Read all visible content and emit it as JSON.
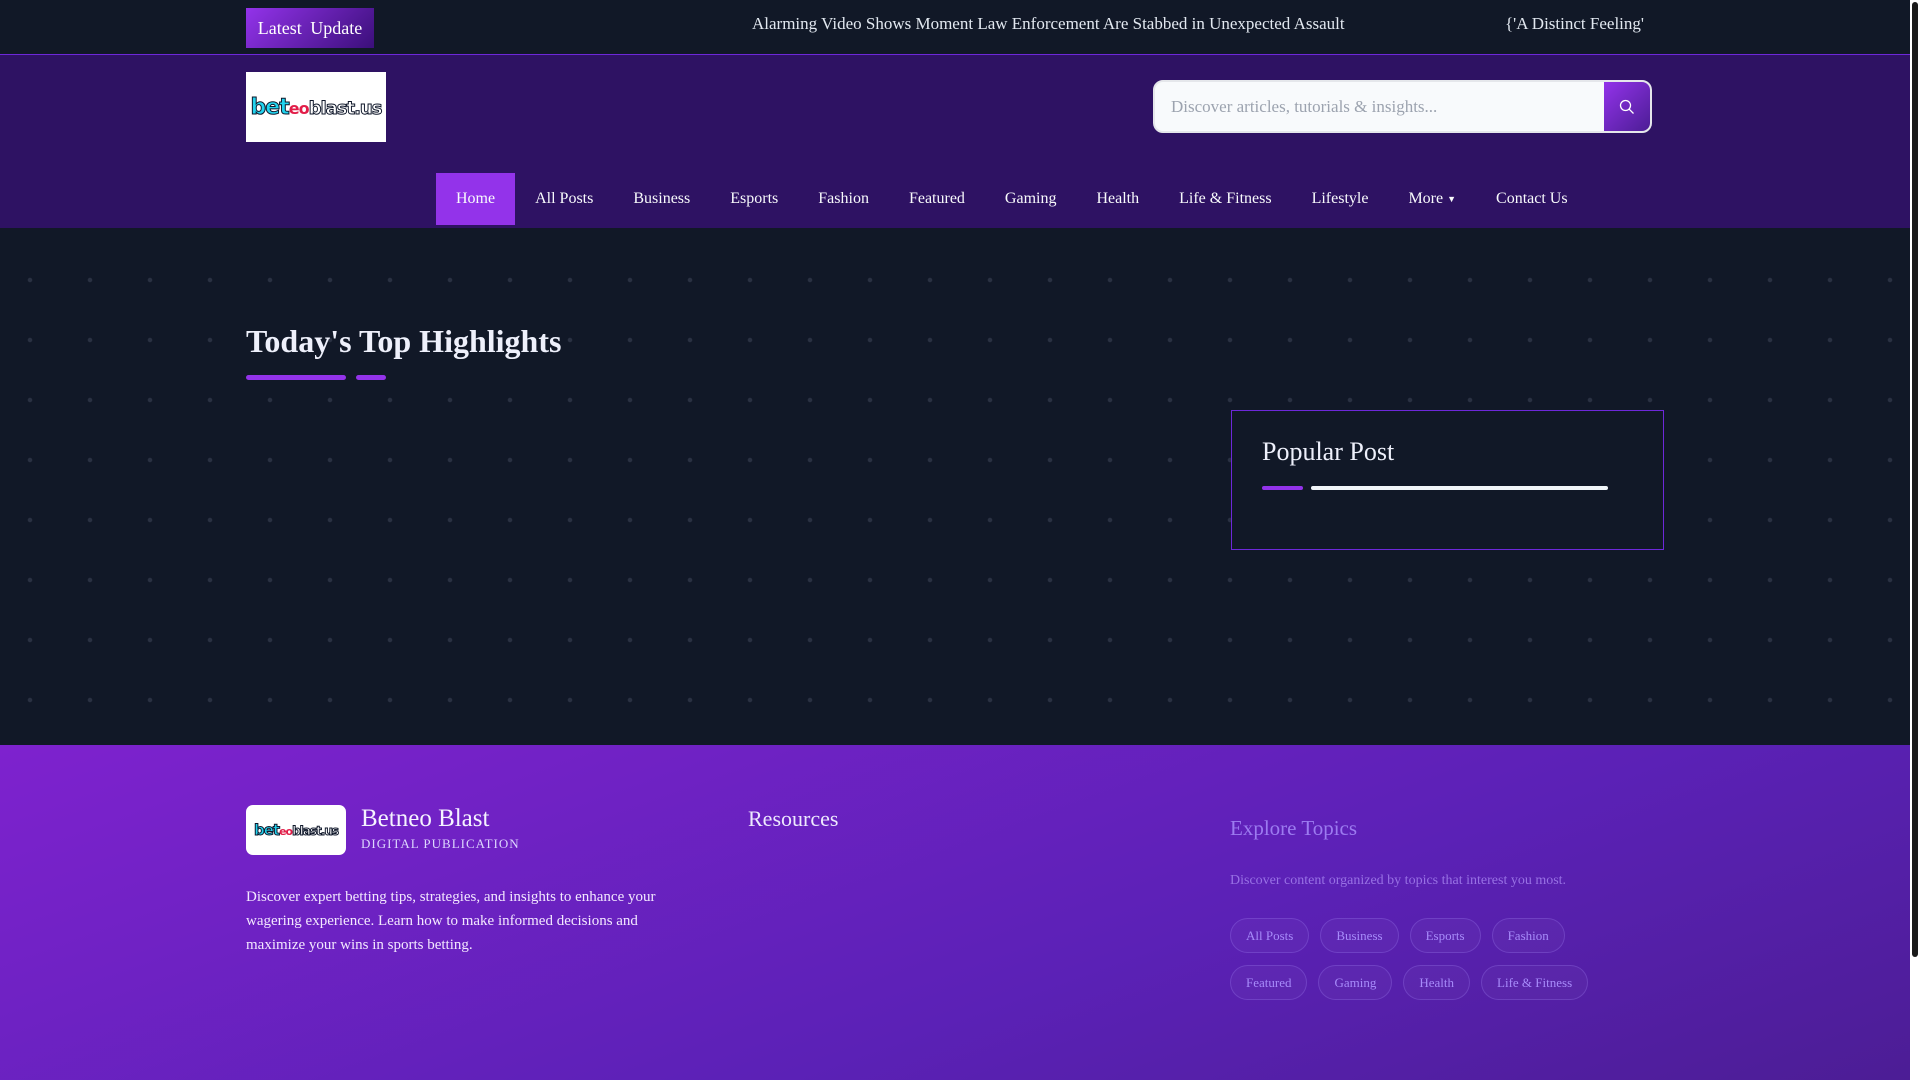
{
  "topbar": {
    "badge": "Latest Update",
    "ticker": [
      "Alarming Video Shows Moment Law Enforcement Are Stabbed in Unexpected Assault",
      "{'A Distinct Feeling'"
    ]
  },
  "header": {
    "logo": "beteoblast.us",
    "search": {
      "placeholder": "Discover articles, tutorials & insights...",
      "value": ""
    }
  },
  "nav": {
    "items": [
      "Home",
      "All Posts",
      "Business",
      "Esports",
      "Fashion",
      "Featured",
      "Gaming",
      "Health",
      "Life & Fitness",
      "Lifestyle",
      "More",
      "Contact Us"
    ],
    "active": "Home"
  },
  "main": {
    "title": "Today's Top Highlights",
    "popular_title": "Popular Post"
  },
  "footer": {
    "brand": "Betneo Blast",
    "tagline": "DIGITAL PUBLICATION",
    "description": "Discover expert betting tips, strategies, and insights to enhance your wagering experience. Learn how to make informed decisions and maximize your wins in sports betting.",
    "resources_title": "Resources",
    "explore_title": "Explore Topics",
    "explore_desc": "Discover content organized by topics that interest you most.",
    "topics": [
      "All Posts",
      "Business",
      "Esports",
      "Fashion",
      "Featured",
      "Gaming",
      "Health",
      "Life & Fitness"
    ]
  },
  "colors": {
    "accent": "#9333ea",
    "header_bg": "#2e1263",
    "page_bg": "#111827"
  }
}
